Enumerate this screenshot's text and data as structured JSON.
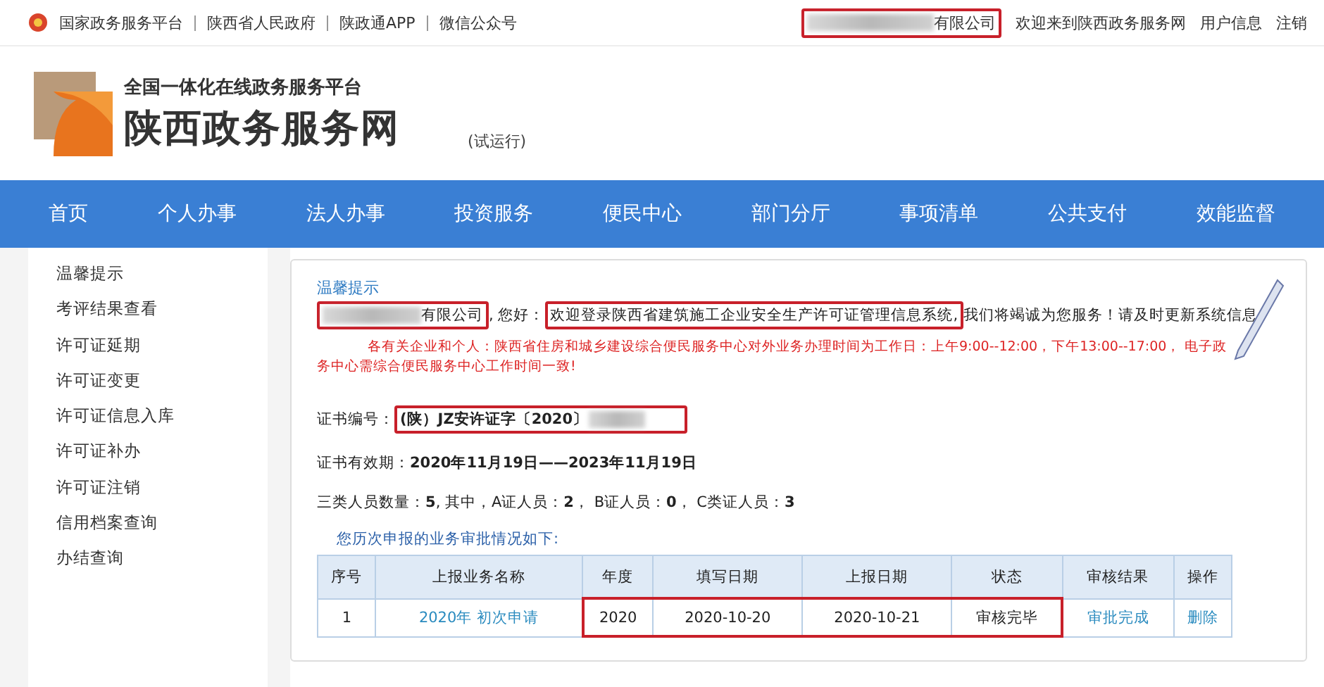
{
  "top_bar": {
    "links": [
      "国家政务服务平台",
      "陕西省人民政府",
      "陕政通APP",
      "微信公众号"
    ],
    "company_suffix": "有限公司",
    "welcome": "欢迎来到陕西政务服务网",
    "user_links": [
      "用户信息",
      "注销"
    ]
  },
  "header": {
    "tagline": "全国一体化在线政务服务平台",
    "site_name": "陕西政务服务网",
    "trial": "(试运行)"
  },
  "nav": [
    {
      "label": "首页"
    },
    {
      "label": "个人办事"
    },
    {
      "label": "法人办事"
    },
    {
      "label": "投资服务"
    },
    {
      "label": "便民中心"
    },
    {
      "label": "部门分厅"
    },
    {
      "label": "事项清单"
    },
    {
      "label": "公共支付"
    },
    {
      "label": "效能监督"
    }
  ],
  "sidebar": {
    "items": [
      "温馨提示",
      "考评结果查看",
      "许可证延期",
      "许可证变更",
      "许可证信息入库",
      "许可证补办",
      "许可证注销",
      "信用档案查询",
      "办结查询"
    ]
  },
  "notice": {
    "title": "温馨提示",
    "company_suffix": "有限公司",
    "greeting": ", 您好：",
    "welcome": "欢迎登录陕西省建筑施工企业安全生产许可证管理信息系统,",
    "service": "我们将竭诚为您服务！请及时更新系统信息",
    "red_notice": "各有关企业和个人：陕西省住房和城乡建设综合便民服务中心对外业务办理时间为工作日：上午9:00--12:00，下午13:00--17:00，   电子政务中心需综合便民服务中心工作时间一致!"
  },
  "certificate": {
    "number_label": "证书编号：",
    "number": "(陕）JZ安许证字〔2020〕",
    "validity_label": "证书有效期：",
    "validity": "2020年11月19日——2023年11月19日",
    "staff": "三类人员数量：**5**, 其中，A证人员：**2**， B证人员：**0**， C类证人员：**3**"
  },
  "history": {
    "title": "您历次申报的业务审批情况如下:",
    "columns": [
      "序号",
      "上报业务名称",
      "年度",
      "填写日期",
      "上报日期",
      "状态",
      "审核结果",
      "操作"
    ],
    "rows": [
      {
        "cells": [
          {
            "text": "1",
            "kind": "text",
            "highlighted": false
          },
          {
            "text": "2020年 初次申请",
            "kind": "link",
            "highlighted": false
          },
          {
            "text": "2020",
            "kind": "text",
            "highlighted": true
          },
          {
            "text": "2020-10-20",
            "kind": "text",
            "highlighted": true
          },
          {
            "text": "2020-10-21",
            "kind": "text",
            "highlighted": true
          },
          {
            "text": "审核完毕",
            "kind": "text",
            "highlighted": true
          },
          {
            "text": "审批完成",
            "kind": "link",
            "highlighted": false
          },
          {
            "text": "删除",
            "kind": "link",
            "highlighted": false
          }
        ]
      }
    ]
  }
}
